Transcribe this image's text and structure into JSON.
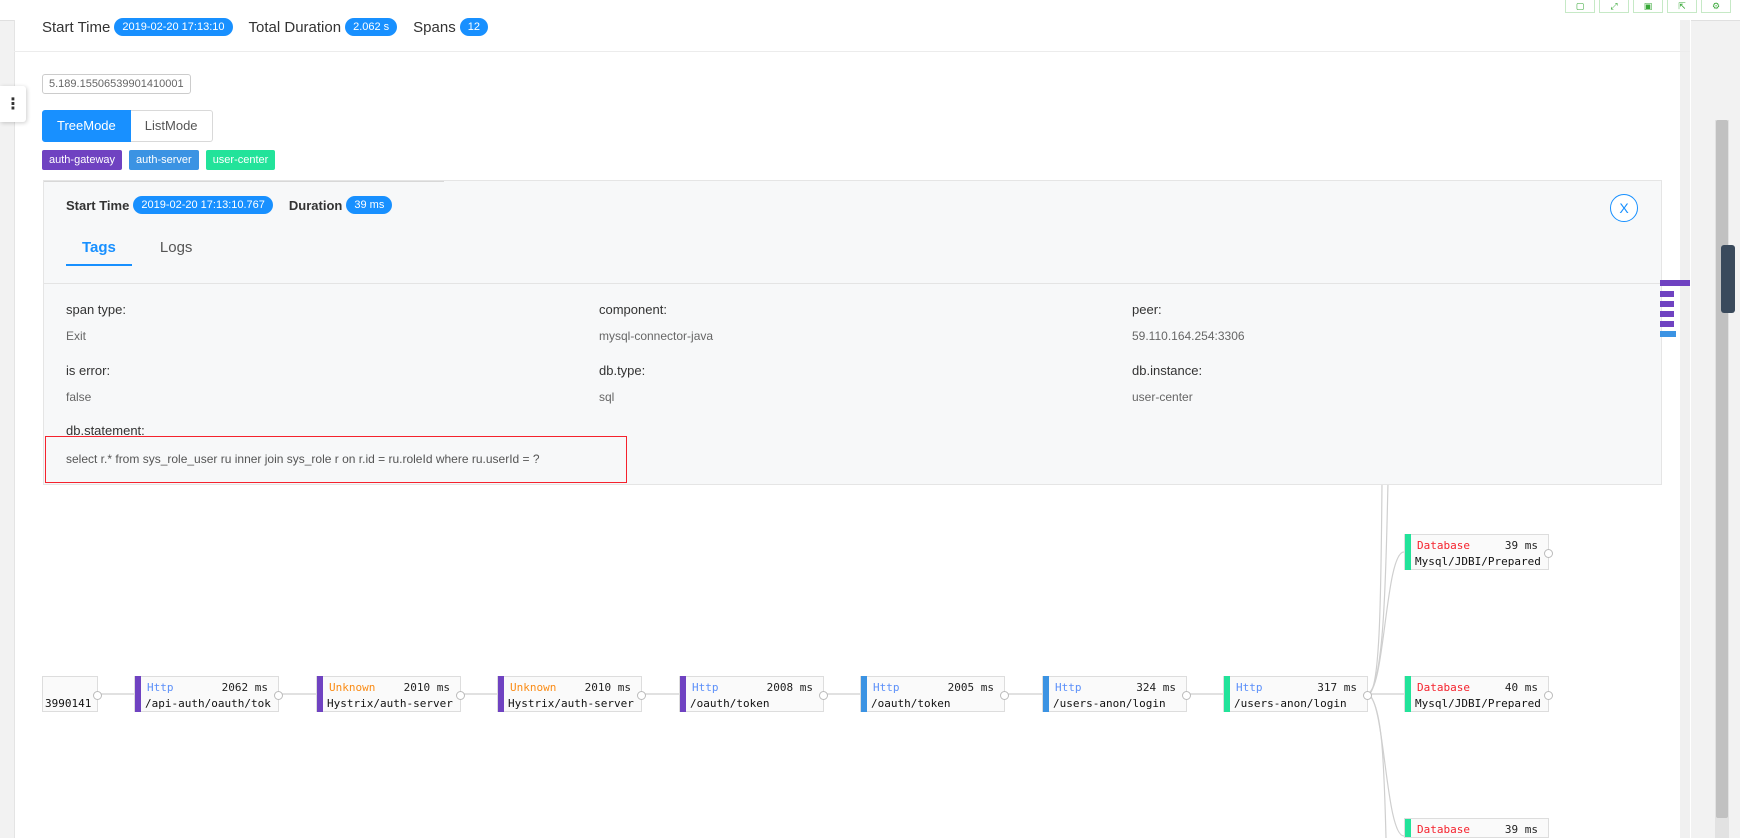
{
  "trace": {
    "start_label": "Start Time",
    "start_value": "2019-02-20 17:13:10",
    "duration_label": "Total Duration",
    "duration_value": "2.062 s",
    "spans_label": "Spans",
    "spans_value": "12",
    "trace_id": "5.189.15506539901410001"
  },
  "modes": {
    "tree": "TreeMode",
    "list": "ListMode",
    "selected": "TreeMode"
  },
  "services": [
    {
      "name": "auth-gateway",
      "color": "#6f42c1"
    },
    {
      "name": "auth-server",
      "color": "#3b93e3"
    },
    {
      "name": "user-center",
      "color": "#22e39a"
    }
  ],
  "detail": {
    "start_label": "Start Time",
    "start_value": "2019-02-20 17:13:10.767",
    "duration_label": "Duration",
    "duration_value": "39 ms",
    "close_symbol": "X",
    "tabs": [
      "Tags",
      "Logs"
    ],
    "active_tab": "Tags",
    "tags": {
      "span_type_key": "span type:",
      "span_type_val": "Exit",
      "component_key": "component:",
      "component_val": "mysql-connector-java",
      "peer_key": "peer:",
      "peer_val": "59.110.164.254:3306",
      "is_error_key": "is error:",
      "is_error_val": "false",
      "db_type_key": "db.type:",
      "db_type_val": "sql",
      "db_instance_key": "db.instance:",
      "db_instance_val": "user-center",
      "db_statement_key": "db.statement:",
      "db_statement_val": "select r.* from sys_role_user ru inner join sys_role r on r.id = ru.roleId where ru.userId = ?"
    }
  },
  "tree_nodes": [
    {
      "type": "",
      "duration": "",
      "endpoint": "3990141",
      "bar_color": ""
    },
    {
      "type": "Http",
      "type_color": "#5b8ff9",
      "duration": "2062 ms",
      "endpoint": "/api-auth/oauth/tok",
      "bar_color": "#6f42c1"
    },
    {
      "type": "Unknown",
      "type_color": "#fa8c16",
      "duration": "2010 ms",
      "endpoint": "Hystrix/auth-server",
      "bar_color": "#6f42c1"
    },
    {
      "type": "Unknown",
      "type_color": "#fa8c16",
      "duration": "2010 ms",
      "endpoint": "Hystrix/auth-server",
      "bar_color": "#6f42c1"
    },
    {
      "type": "Http",
      "type_color": "#5b8ff9",
      "duration": "2008 ms",
      "endpoint": "/oauth/token",
      "bar_color": "#6f42c1"
    },
    {
      "type": "Http",
      "type_color": "#5b8ff9",
      "duration": "2005 ms",
      "endpoint": "/oauth/token",
      "bar_color": "#3b93e3"
    },
    {
      "type": "Http",
      "type_color": "#5b8ff9",
      "duration": "324 ms",
      "endpoint": "/users-anon/login",
      "bar_color": "#3b93e3"
    },
    {
      "type": "Http",
      "type_color": "#5b8ff9",
      "duration": "317 ms",
      "endpoint": "/users-anon/login",
      "bar_color": "#22e39a"
    },
    {
      "type": "Database",
      "type_color": "#f5222d",
      "duration": "40 ms",
      "endpoint": "Mysql/JDBI/Prepared",
      "bar_color": "#22e39a"
    },
    {
      "type": "Database",
      "type_color": "#f5222d",
      "duration": "39 ms",
      "endpoint": "Mysql/JDBI/Prepared",
      "bar_color": "#22e39a"
    },
    {
      "type": "Database",
      "type_color": "#f5222d",
      "duration": "39 ms",
      "endpoint": "",
      "bar_color": "#22e39a"
    }
  ],
  "toolbar": [
    "save-icon",
    "fullscreen-icon",
    "download-icon",
    "export-icon",
    "settings-icon"
  ],
  "minimap_colors": [
    "#6f42c1",
    "#6f42c1",
    "#6f42c1",
    "#6f42c1",
    "#6f42c1",
    "#3b93e3"
  ]
}
